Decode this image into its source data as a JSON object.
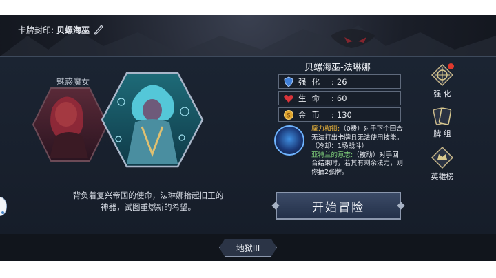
{
  "header": {
    "card_seal_label": "卡牌封印:",
    "card_seal_name": "贝螺海巫"
  },
  "left_card": {
    "name": "魅惑魔女"
  },
  "hero": {
    "title": "贝螺海巫-法琳娜",
    "description_lines": [
      "背负着复兴帝国的使命，法琳娜拾起旧王的",
      "神器，试图重燃新的希望。"
    ],
    "stats": [
      {
        "icon": "shield-icon",
        "label": "强化",
        "value": "26",
        "color": "#3f7fd8"
      },
      {
        "icon": "heart-icon",
        "label": "生命",
        "value": "60",
        "color": "#d8333a"
      },
      {
        "icon": "coin-icon",
        "label": "金币",
        "value": "130",
        "color": "#e0a62f"
      }
    ],
    "skills": [
      {
        "name": "魔力枷锁:",
        "text": "（0费）对手下个回合无法打出卡牌且无法使用技能。（冷却：1场战斗）"
      },
      {
        "name": "亚特兰的意志:",
        "text": "（被动）对手回合结束时，若其有剩余法力，则你抽2张牌。"
      }
    ]
  },
  "actions": {
    "start_adventure": "开始冒险"
  },
  "side_menu": [
    {
      "icon": "enhance-icon",
      "label": "强 化",
      "badge": "!"
    },
    {
      "icon": "deck-icon",
      "label": "牌 组"
    },
    {
      "icon": "leaderboard-icon",
      "label": "英雄榜"
    }
  ],
  "difficulty": {
    "label": "地狱III"
  }
}
